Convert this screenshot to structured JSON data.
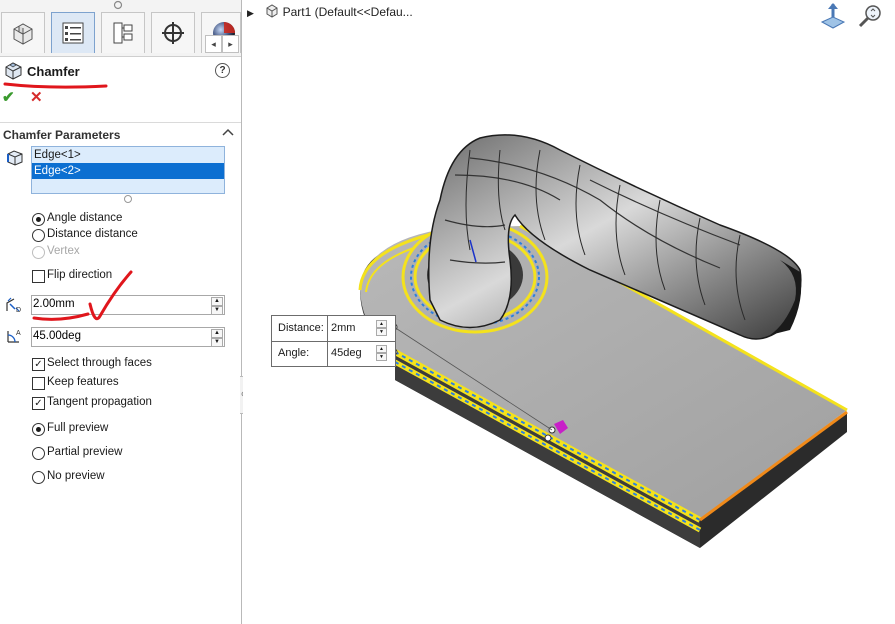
{
  "feature_manager": {
    "title": "Chamfer",
    "ok_symbol": "✔",
    "cancel_symbol": "✕",
    "help_symbol": "?",
    "nav_left": "◂",
    "nav_right": "▸"
  },
  "chamfer_parameters": {
    "section_title": "Chamfer Parameters",
    "edges": [
      "Edge<1>",
      "Edge<2>"
    ],
    "selected_edge_index": 1,
    "type_options": [
      {
        "label": "Angle distance",
        "selected": true,
        "enabled": true
      },
      {
        "label": "Distance distance",
        "selected": false,
        "enabled": true
      },
      {
        "label": "Vertex",
        "selected": false,
        "enabled": false
      }
    ],
    "flip_direction": {
      "label": "Flip direction",
      "checked": false
    },
    "distance_value": "2.00mm",
    "angle_value": "45.00deg"
  },
  "options": {
    "checkboxes": [
      {
        "label": "Select through faces",
        "checked": true
      },
      {
        "label": "Keep features",
        "checked": false
      },
      {
        "label": "Tangent propagation",
        "checked": true
      }
    ],
    "preview_options": [
      {
        "label": "Full preview",
        "selected": true
      },
      {
        "label": "Partial preview",
        "selected": false
      },
      {
        "label": "No preview",
        "selected": false
      }
    ]
  },
  "graphics_area": {
    "tree_header": "Part1  (Default<<Defau...",
    "callout": {
      "distance_label": "Distance:",
      "distance_value": "2mm",
      "angle_label": "Angle:",
      "angle_value": "45deg"
    }
  },
  "colors": {
    "selection_blue": "#0c6fd1",
    "highlight_yellow": "#f4e21c",
    "annotation_red": "#e0161c",
    "edge_orange": "#f08a1a",
    "handle_magenta": "#c81fc8"
  }
}
